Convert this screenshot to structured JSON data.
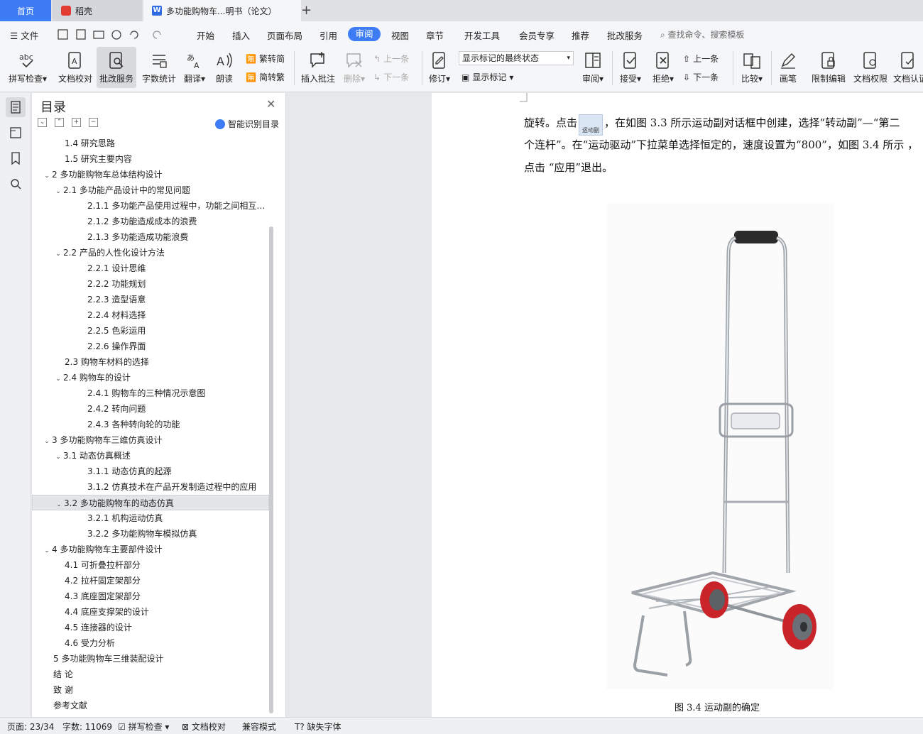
{
  "tabs": {
    "home": "首页",
    "daoke": "稻壳",
    "doc": "多功能购物车...明书（论文）"
  },
  "menu": {
    "file": "文件",
    "items": [
      "开始",
      "插入",
      "页面布局",
      "引用",
      "审阅",
      "视图",
      "章节",
      "开发工具",
      "会员专享",
      "推荐",
      "批改服务"
    ],
    "active": "审阅",
    "search_hint": "查找命令、搜索模板"
  },
  "ribbon": {
    "spell_check": "拼写检查",
    "doc_proof": "文档校对",
    "correction_service": "批改服务",
    "word_count": "字数统计",
    "translate": "翻译",
    "read_aloud": "朗读",
    "trad_to_simp": "繁转简",
    "simp_to_trad": "简转繁",
    "insert_comment": "插入批注",
    "delete": "删除",
    "prev": "上一条",
    "next": "下一条",
    "revise": "修订",
    "markup_state": "显示标记的最终状态",
    "show_markup": "显示标记",
    "review": "审阅",
    "accept": "接受",
    "reject": "拒绝",
    "prev2": "上一条",
    "next2": "下一条",
    "compare": "比较",
    "pen": "画笔",
    "restrict_edit": "限制编辑",
    "doc_permission": "文档权限",
    "doc_cert": "文档认证"
  },
  "toc": {
    "title": "目录",
    "smart": "智能识别目录",
    "items": [
      {
        "text": "1.4 研究思路",
        "level": 2,
        "chev": false
      },
      {
        "text": "1.5 研究主要内容",
        "level": 2,
        "chev": false
      },
      {
        "text": "2  多功能购物车总体结构设计",
        "level": 1,
        "chev": true
      },
      {
        "text": "2.1  多功能产品设计中的常见问题",
        "level": 2,
        "chev": true
      },
      {
        "text": "2.1.1  多功能产品使用过程中，功能之间相互影...",
        "level": 3,
        "chev": false
      },
      {
        "text": "2.1.2  多功能造成成本的浪费",
        "level": 3,
        "chev": false
      },
      {
        "text": "2.1.3  多功能造成功能浪费",
        "level": 3,
        "chev": false
      },
      {
        "text": "2.2  产品的人性化设计方法",
        "level": 2,
        "chev": true
      },
      {
        "text": "2.2.1  设计思维",
        "level": 3,
        "chev": false
      },
      {
        "text": "2.2.2  功能规划",
        "level": 3,
        "chev": false
      },
      {
        "text": "2.2.3  造型语意",
        "level": 3,
        "chev": false
      },
      {
        "text": "2.2.4  材料选择",
        "level": 3,
        "chev": false
      },
      {
        "text": "2.2.5  色彩运用",
        "level": 3,
        "chev": false
      },
      {
        "text": "2.2.6  操作界面",
        "level": 3,
        "chev": false
      },
      {
        "text": "2.3  购物车材料的选择",
        "level": 2,
        "chev": false
      },
      {
        "text": "2.4  购物车的设计",
        "level": 2,
        "chev": true
      },
      {
        "text": "2.4.1  购物车的三种情况示意图",
        "level": 3,
        "chev": false
      },
      {
        "text": "2.4.2  转向问题",
        "level": 3,
        "chev": false
      },
      {
        "text": "2.4.3 各种转向轮的功能",
        "level": 3,
        "chev": false
      },
      {
        "text": "3  多功能购物车三维仿真设计",
        "level": 1,
        "chev": true
      },
      {
        "text": "3.1  动态仿真概述",
        "level": 2,
        "chev": true
      },
      {
        "text": "3.1.1  动态仿真的起源",
        "level": 3,
        "chev": false
      },
      {
        "text": "3.1.2  仿真技术在产品开发制造过程中的应用",
        "level": 3,
        "chev": false
      },
      {
        "text": "3.2  多功能购物车的动态仿真",
        "level": 2,
        "chev": true,
        "selected": true
      },
      {
        "text": "3.2.1  机构运动仿真",
        "level": 3,
        "chev": false
      },
      {
        "text": "3.2.2  多功能购物车模拟仿真",
        "level": 3,
        "chev": false
      },
      {
        "text": "4  多功能购物车主要部件设计",
        "level": 1,
        "chev": true
      },
      {
        "text": "4.1  可折叠拉杆部分",
        "level": 2,
        "chev": false
      },
      {
        "text": "4.2  拉杆固定架部分",
        "level": 2,
        "chev": false
      },
      {
        "text": "4.3  底座固定架部分",
        "level": 2,
        "chev": false
      },
      {
        "text": "4.4 底座支撑架的设计",
        "level": 2,
        "chev": false
      },
      {
        "text": "4.5 连接器的设计",
        "level": 2,
        "chev": false
      },
      {
        "text": "4.6  受力分析",
        "level": 2,
        "chev": false
      },
      {
        "text": "5  多功能购物车三维装配设计",
        "level": 1,
        "chev": false
      },
      {
        "text": "结    论",
        "level": 1,
        "chev": false
      },
      {
        "text": "致    谢",
        "level": 1,
        "chev": false
      },
      {
        "text": "参考文献",
        "level": 1,
        "chev": false
      }
    ]
  },
  "doc": {
    "line1_before": "旋转。点击",
    "icon_label": "运动副",
    "line1_after": "，在如图 3.3 所示运动副对话框中创建，选择“转动副”—“第二",
    "line2": "个连杆”。在“运动驱动”下拉菜单选择恒定的，速度设置为“800”，如图  3.4 所示 ，",
    "line3": "点击  “应用”退出。",
    "caption": "图 3.4  运动副的确定"
  },
  "status": {
    "page": "页面: 23/34",
    "words": "字数: 11069",
    "spell": "拼写检查",
    "proof": "文档校对",
    "compat": "兼容模式",
    "missing_font": "缺失字体"
  },
  "colors": {
    "accent": "#3d7cf4",
    "wheel": "#c8242a"
  }
}
